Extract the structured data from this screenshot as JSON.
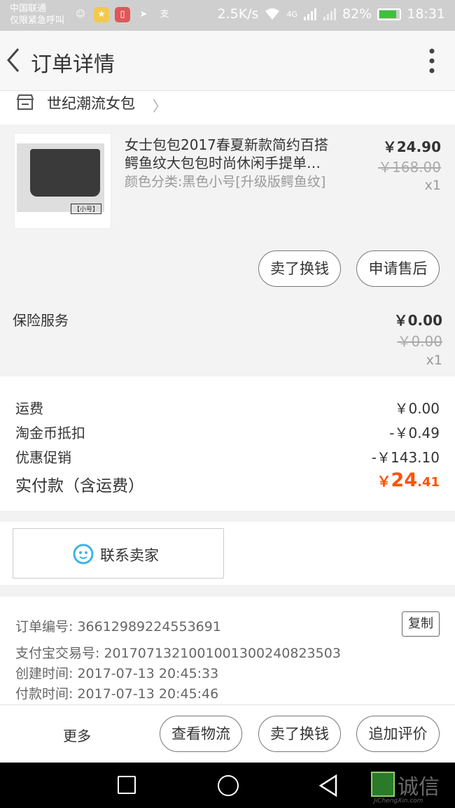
{
  "status_bar": {
    "carrier_line1": "中国联通",
    "carrier_line2": "仅限紧急呼叫",
    "net_speed": "2.5K/s",
    "network": "4G",
    "battery": "82%",
    "time": "18:31"
  },
  "header": {
    "title": "订单详情"
  },
  "shop": {
    "name": "世纪潮流女包"
  },
  "product": {
    "title_line1": "女士包包2017春夏新款简约百搭",
    "title_line2": "鳄鱼纹大包包时尚休闲手提单…",
    "sku": "颜色分类:黑色小号[升级版鳄鱼纹]",
    "price": "￥24.90",
    "original_price": "￥168.00",
    "quantity": "x1",
    "thumb_tag": "【小号】",
    "btn_sell": "卖了换钱",
    "btn_aftersale": "申请售后"
  },
  "insurance": {
    "label": "保险服务",
    "price": "￥0.00",
    "original_price": "￥0.00",
    "quantity": "x1"
  },
  "costs": {
    "shipping_label": "运费",
    "shipping_value": "￥0.00",
    "coin_label": "淘金币抵扣",
    "coin_value": "-￥0.49",
    "promo_label": "优惠促销",
    "promo_value": "-￥143.10",
    "total_label": "实付款（含运费）",
    "total_symbol": "￥",
    "total_int": "24",
    "total_dec": ".41"
  },
  "contact": {
    "label": "联系卖家"
  },
  "order_info": {
    "order_no": "订单编号: 36612989224553691",
    "alipay_no": "支付宝交易号: 2017071321001001300240823503",
    "created": "创建时间: 2017-07-13 20:45:33",
    "paid": "付款时间: 2017-07-13 20:45:46",
    "copy_label": "复制"
  },
  "actions": {
    "more": "更多",
    "logistics": "查看物流",
    "sell": "卖了换钱",
    "review": "追加评价"
  },
  "watermark": {
    "text": "诚信",
    "sub": "JiChengXin.com"
  },
  "colors": {
    "accent": "#ff5000",
    "status_bar": "#cfcfcf",
    "contact_icon": "#3cb4e6"
  }
}
